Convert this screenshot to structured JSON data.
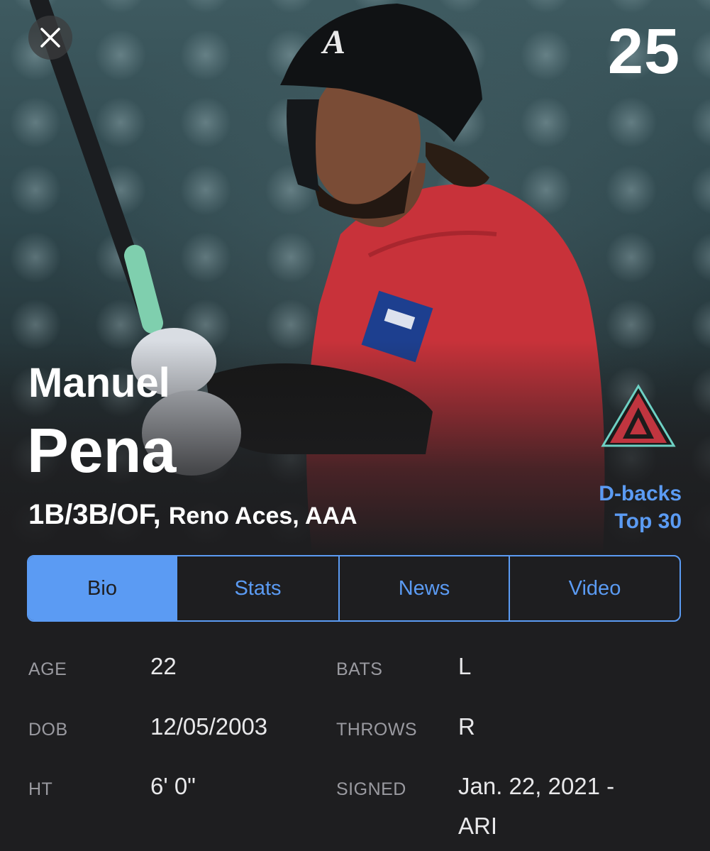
{
  "header": {
    "close_icon": "close-icon",
    "jersey_number": "25"
  },
  "player": {
    "first_name": "Manuel",
    "last_name": "Pena",
    "positions": "1B/3B/OF,",
    "team_level": "Reno Aces, AAA",
    "team_logo": "d-backs-a-logo",
    "rank_line1": "D-backs",
    "rank_line2": "Top 30"
  },
  "tabs": [
    {
      "label": "Bio",
      "active": true
    },
    {
      "label": "Stats",
      "active": false
    },
    {
      "label": "News",
      "active": false
    },
    {
      "label": "Video",
      "active": false
    }
  ],
  "bio": {
    "age_label": "AGE",
    "age_value": "22",
    "dob_label": "DOB",
    "dob_value": "12/05/2003",
    "ht_label": "HT",
    "ht_value": "6' 0\"",
    "bats_label": "BATS",
    "bats_value": "L",
    "throws_label": "THROWS",
    "throws_value": "R",
    "signed_label": "SIGNED",
    "signed_value_line1": "Jan. 22, 2021 -",
    "signed_value_line2": "ARI"
  },
  "colors": {
    "accent": "#5b9bf3",
    "background": "#1e1e20",
    "jersey_red": "#c8323a"
  }
}
